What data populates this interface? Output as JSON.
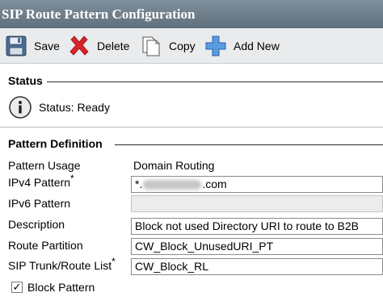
{
  "title": "SIP Route Pattern Configuration",
  "toolbar": {
    "save": {
      "label": "Save",
      "icon": "floppy-disk-icon"
    },
    "delete": {
      "label": "Delete",
      "icon": "red-x-icon"
    },
    "copy": {
      "label": "Copy",
      "icon": "copy-document-icon"
    },
    "add_new": {
      "label": "Add New",
      "icon": "blue-plus-icon"
    }
  },
  "status": {
    "heading": "Status",
    "text": "Status: Ready",
    "icon": "info-icon"
  },
  "pattern_definition": {
    "heading": "Pattern Definition",
    "fields": {
      "pattern_usage": {
        "label": "Pattern Usage",
        "value": "Domain Routing"
      },
      "ipv4_pattern": {
        "label": "IPv4 Pattern",
        "required": "*",
        "value_prefix": "*.",
        "value_suffix": ".com"
      },
      "ipv6_pattern": {
        "label": "IPv6 Pattern",
        "value": ""
      },
      "description": {
        "label": "Description",
        "value": "Block not used Directory URI to route to B2B"
      },
      "route_partition": {
        "label": "Route Partition",
        "value": "CW_Block_UnusedURI_PT"
      },
      "sip_trunk": {
        "label": "SIP Trunk/Route List",
        "required": "*",
        "value": "CW_Block_RL"
      }
    },
    "block_pattern": {
      "label": "Block Pattern",
      "checked": true
    }
  },
  "colors": {
    "titlebar": "#6f7f8c",
    "toolbar": "#e9ebed",
    "delete_red": "#d9232a",
    "add_blue": "#3a7fd0"
  }
}
